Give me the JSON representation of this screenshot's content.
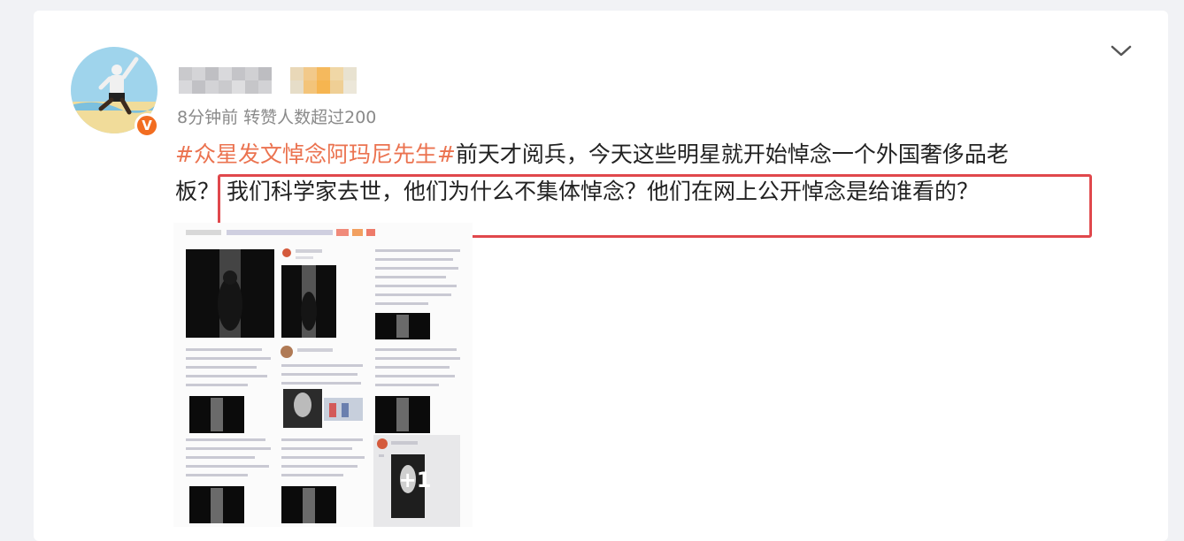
{
  "post": {
    "meta": "8分钟前 转赞人数超过200",
    "topic": "#众星发文悼念阿玛尼先生#",
    "text_part1": "前天才阅兵，今天这些明星就开始悼念一个外国奢侈品老",
    "text_part2_prefix": "板？",
    "text_highlighted": "我们科学家去世，他们为什么不集体悼念？他们在网上公开悼念是给谁看的？",
    "verified_badge": "V",
    "more_images_label": "+1"
  },
  "icons": {
    "menu": "chevron-down-icon",
    "badge": "verified-badge-icon"
  },
  "colors": {
    "topic": "#eb7350",
    "highlight_border": "#e0484c",
    "badge": "#f26d21"
  }
}
